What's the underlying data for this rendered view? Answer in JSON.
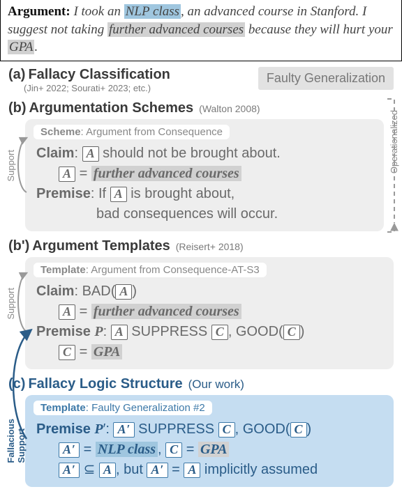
{
  "argument": {
    "label": "Argument:",
    "t1": "I took an ",
    "nlp": "NLP class",
    "t2": ", an advanced course in Stanford. I suggest not taking ",
    "fac": "further advanced courses",
    "t3": " because they will hurt your ",
    "gpa": "GPA",
    "t4": "."
  },
  "a": {
    "id": "(a)",
    "title": "Fallacy Classification",
    "ref": "(Jin+ 2022; Sourati+ 2023; etc.)",
    "badge": "Faulty Generalization"
  },
  "b": {
    "id": "(b)",
    "title": "Argumentation Schemes",
    "ref": "(Walton 2008)",
    "tag_label": "Scheme",
    "tag_value": "Argument from Consequence",
    "claim_label": "Claim",
    "claim_text": " should not be brought about.",
    "var_a": "A",
    "eq": " = ",
    "a_value": "further advanced courses",
    "premise_label": "Premise",
    "premise_t1": "If ",
    "premise_t2": " is brought about,",
    "premise_t3": "bad consequences will occur."
  },
  "bp": {
    "id": "(b')",
    "title": "Argument Templates",
    "ref": "(Reisert+ 2018)",
    "tag_label": "Template",
    "tag_value": "Argument from Consequence-AT-S3",
    "claim_label": "Claim",
    "claim_text": "BAD(",
    "close": ")",
    "var_a": "A",
    "eq": " = ",
    "a_value": "further advanced courses",
    "premise_label": "Premise ",
    "premise_p": "P",
    "colon": ": ",
    "suppress": " SUPPRESS ",
    "var_c": "C",
    "good": ", GOOD(",
    "c_value": "GPA"
  },
  "c": {
    "id": "(c)",
    "title": "Fallacy Logic Structure",
    "ref": "(Our work)",
    "tag_label": "Template",
    "tag_value": "Faulty Generalization #2",
    "premise_label": "Premise ",
    "premise_p": "P",
    "colon": ": ",
    "var_a": "A",
    "suppress": " SUPPRESS ",
    "var_c": "C",
    "good": ", GOOD(",
    "close": ")",
    "eq": " = ",
    "a_value": "NLP class",
    "c_value": "GPA",
    "subset": " ⊆ ",
    "but": ", but ",
    "eq2": " = ",
    "implicit": " implicitly assumed"
  },
  "labels": {
    "support": "Support",
    "fallacious_support": "Fallacious\nSupport",
    "operationalized": "Operationalized"
  }
}
